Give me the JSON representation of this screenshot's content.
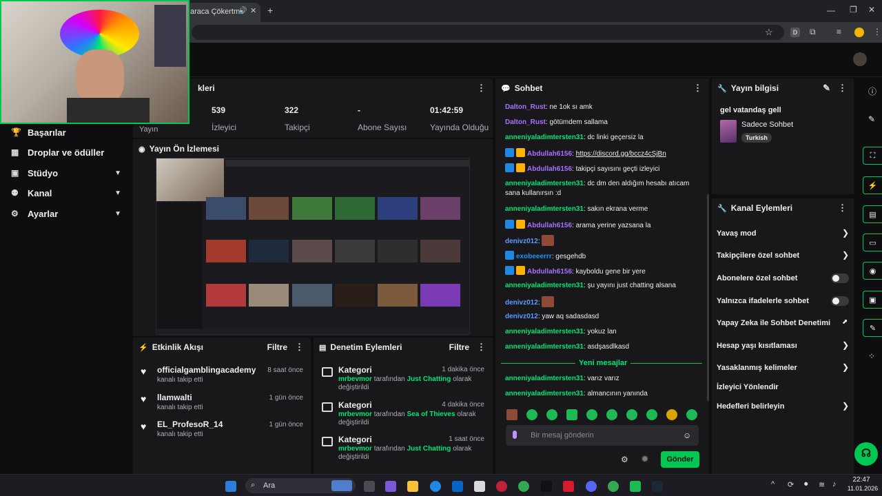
{
  "browser": {
    "tab_title": "araca Çökertme",
    "new_tab": "+"
  },
  "nav": {
    "items": [
      {
        "label": "Başarılar",
        "icon": "trophy-icon"
      },
      {
        "label": "Droplar ve ödüller",
        "icon": "gift-icon"
      },
      {
        "label": "Stüdyo",
        "icon": "studio-icon"
      },
      {
        "label": "Kanal",
        "icon": "channel-icon"
      },
      {
        "label": "Ayarlar",
        "icon": "gear-icon"
      }
    ],
    "partial_header": "kleri",
    "partial_label": "Yayın"
  },
  "stats": {
    "items": [
      {
        "value": "539",
        "label": "İzleyici"
      },
      {
        "value": "322",
        "label": "Takipçi"
      },
      {
        "value": "-",
        "label": "Abone Sayısı"
      },
      {
        "value": "01:42:59",
        "label": "Yayında Olduğu"
      }
    ]
  },
  "preview": {
    "title": "Yayın Ön İzlemesi"
  },
  "activity": {
    "title": "Etkinlik Akışı",
    "filter": "Filtre",
    "items": [
      {
        "name": "officialgamblingacademy",
        "action": "kanalı takip etti",
        "time": "8 saat önce"
      },
      {
        "name": "llamwalti",
        "action": "kanalı takip etti",
        "time": "1 gün önce"
      },
      {
        "name": "EL_ProfesoR_14",
        "action": "kanalı takip etti",
        "time": "1 gün önce"
      }
    ]
  },
  "moderation": {
    "title": "Denetim Eylemleri",
    "filter": "Filtre",
    "items": [
      {
        "title": "Kategori",
        "time": "1 dakika önce",
        "user": "mrbevmor",
        "mid": "tarafından",
        "game": "Just Chatting",
        "tail": "olarak",
        "end": "değiştirildi"
      },
      {
        "title": "Kategori",
        "time": "4 dakika önce",
        "user": "mrbevmor",
        "mid": "tarafından",
        "game": "Sea of Thieves",
        "tail": "olarak",
        "end": "değiştirildi"
      },
      {
        "title": "Kategori",
        "time": "1 saat önce",
        "user": "mrbevmor",
        "mid": "tarafından",
        "game": "Just Chatting",
        "tail": "olarak",
        "end": "değiştirildi"
      }
    ]
  },
  "chat": {
    "title": "Sohbet",
    "messages": [
      {
        "user": "Dalton_Rust",
        "text": "ne 1ok sı amk",
        "color": "#a970ff"
      },
      {
        "user": "Dalton_Rust",
        "text": "götümdem sallama",
        "color": "#a970ff"
      },
      {
        "user": "anneniyaladimtersten31",
        "text": "dc linki geçersiz la",
        "color": "#00e676"
      },
      {
        "user": "Abdullah6156",
        "text": "https://discord.gg/bccz4cSjBn",
        "color": "#a970ff"
      },
      {
        "user": "Abdullah6156",
        "text": "takipçi sayısını geçti izleyici",
        "color": "#a970ff"
      },
      {
        "user": "anneniyaladimtersten31",
        "text": "dc dm den aldığım hesabı atıcam sana kullanırsın :d",
        "color": "#00e676"
      },
      {
        "user": "anneniyaladimtersten31",
        "text": "sakın ekrana verme",
        "color": "#00e676"
      },
      {
        "user": "Abdullah6156",
        "text": "arama yerine yazsana la",
        "color": "#a970ff"
      },
      {
        "user": "denivz012",
        "text": "",
        "color": "#5c9cff"
      },
      {
        "user": "exobeeerrr",
        "text": "gesgehdb",
        "color": "#1e90ff"
      },
      {
        "user": "Abdullah6156",
        "text": "kayboldu gene bir yere",
        "color": "#a970ff"
      },
      {
        "user": "anneniyaladimtersten31",
        "text": "şu yayını just chatting alsana",
        "color": "#00e676"
      },
      {
        "user": "denivz012",
        "text": "",
        "color": "#5c9cff"
      },
      {
        "user": "denivz012",
        "text": "yaw aq sadasdasd",
        "color": "#5c9cff"
      },
      {
        "user": "anneniyaladimtersten31",
        "text": "yokuz lan",
        "color": "#00e676"
      },
      {
        "user": "anneniyaladimtersten31",
        "text": "asdşasdlkasd",
        "color": "#00e676"
      },
      {
        "user": "anneniyaladimtersten31",
        "text": "varız varız",
        "color": "#00e676"
      },
      {
        "user": "anneniyaladimtersten31",
        "text": "almancının yanında",
        "color": "#00e676"
      }
    ],
    "new_messages": "Yeni mesajlar",
    "input_placeholder": "Bir mesaj gönderin",
    "send": "Gönder"
  },
  "info": {
    "title": "Yayın bilgisi",
    "stream_title": "gel vatandaş gell",
    "category": "Sadece Sohbet",
    "tag": "Turkish"
  },
  "channel_actions": {
    "title": "Kanal Eylemleri",
    "items": [
      {
        "label": "Yavaş mod",
        "control": "chevron"
      },
      {
        "label": "Takipçilere özel sohbet",
        "control": "chevron"
      },
      {
        "label": "Abonelere özel sohbet",
        "control": "toggle"
      },
      {
        "label": "Yalnızca ifadelerle sohbet",
        "control": "toggle"
      },
      {
        "label": "Yapay Zeka ile Sohbet Denetimi",
        "control": "external"
      },
      {
        "label": "Hesap yaşı kısıtlaması",
        "control": "chevron"
      },
      {
        "label": "Yasaklanmış kelimeler",
        "control": "chevron"
      },
      {
        "label": "İzleyici Yönlendir",
        "control": "none"
      },
      {
        "label": "Hedefleri belirleyin",
        "control": "chevron"
      }
    ]
  },
  "taskbar": {
    "search": "Ara",
    "time": "22:47",
    "date": "11.01.2026"
  }
}
